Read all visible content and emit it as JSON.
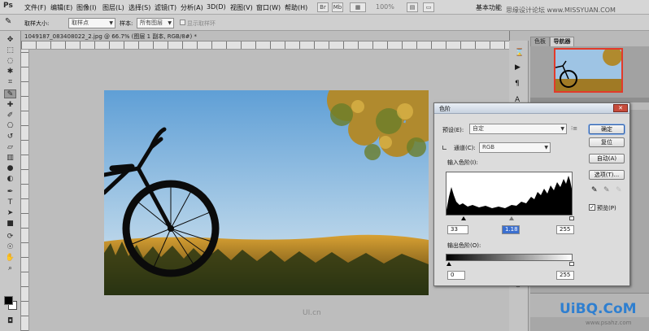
{
  "app": {
    "logo": "Ps"
  },
  "menu": [
    "文件(F)",
    "编辑(E)",
    "图像(I)",
    "图层(L)",
    "选择(S)",
    "滤镜(T)",
    "分析(A)",
    "3D(D)",
    "视图(V)",
    "窗口(W)",
    "帮助(H)"
  ],
  "menu_right": {
    "zoom": "100%",
    "workspace": "基本功能"
  },
  "options": {
    "tool_label": "取样大小:",
    "sample_size": "取样点",
    "sample_label": "样本:",
    "sample_value": "所有图层",
    "show_ring": "显示取样环"
  },
  "document": {
    "tab": "1049187_083408022_2.jpg @ 66.7% (图层 1 副本, RGB/8#) *"
  },
  "panels": {
    "tab_color": "色板",
    "tab_nav": "导航器"
  },
  "levels": {
    "title": "色阶",
    "preset_label": "预设(E):",
    "preset_value": "自定",
    "channel_label": "通道(C):",
    "channel_value": "RGB",
    "input_label": "输入色阶(I):",
    "input_black": "33",
    "input_gamma": "1.18",
    "input_white": "255",
    "output_label": "输出色阶(O):",
    "output_black": "0",
    "output_white": "255",
    "btn_ok": "确定",
    "btn_reset": "复位",
    "btn_auto": "自动(A)",
    "btn_options": "选项(T)...",
    "preview_label": "预览(P)",
    "preview_checked": true
  },
  "watermarks": {
    "top": "思缘设计论坛 www.MISSYUAN.COM",
    "center": "UI.cn",
    "brand": "UiBQ.CoM",
    "site": "www.psahz.com"
  }
}
